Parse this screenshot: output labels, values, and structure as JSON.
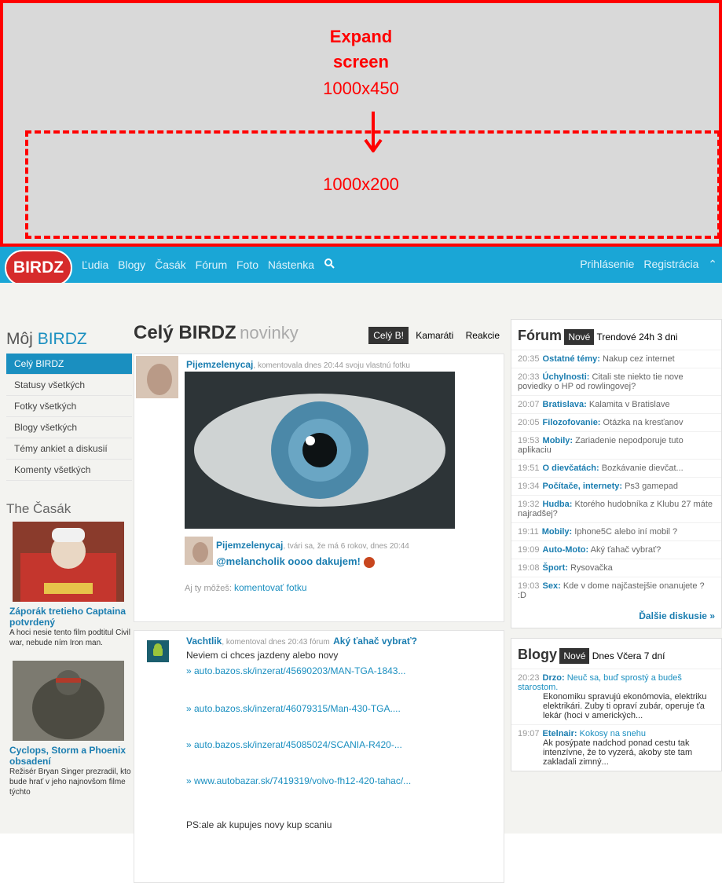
{
  "banner": {
    "title_line1": "Expand",
    "title_line2": "screen",
    "size_expanded": "1000x450",
    "size_collapsed": "1000x200"
  },
  "nav": {
    "logo": "BIRDZ",
    "links": [
      "Ľudia",
      "Blogy",
      "Časák",
      "Fórum",
      "Foto",
      "Nástenka"
    ],
    "login": "Prihlásenie",
    "register": "Registrácia"
  },
  "sidebar": {
    "title_prefix": "Môj",
    "title_brand": "BIRDZ",
    "items": [
      "Celý BIRDZ",
      "Statusy všetkých",
      "Fotky všetkých",
      "Blogy všetkých",
      "Témy ankiet a diskusií",
      "Komenty všetkých"
    ]
  },
  "casak": {
    "title": "The Časák",
    "articles": [
      {
        "headline": "Záporák tretieho Captaina potvrdený",
        "text": "A hoci nesie tento film podtitul Civil war, nebude ním Iron man."
      },
      {
        "headline": "Cyclops, Storm a Phoenix obsadení",
        "text": "Režisér Bryan Singer prezradil, kto bude hrať v jeho najnovšom filme týchto"
      }
    ]
  },
  "feed": {
    "title": "Celý BIRDZ",
    "subtitle": "novinky",
    "tabs": [
      "Celý B!",
      "Kamaráti",
      "Reakcie"
    ],
    "post1": {
      "author": "Pijemzelenycaj",
      "meta": ", komentovala dnes 20:44 svoju vlastnú fotku",
      "reply_author": "Pijemzelenycaj",
      "reply_meta": ", tvári sa, že má 6 rokov, dnes 20:44",
      "reply_text": "@melancholik oooo dakujem!",
      "cta_prefix": "Aj ty môžeš:",
      "cta": "komentovať fotku"
    },
    "post2": {
      "author": "Vachtlik",
      "meta": ", komentoval dnes 20:43 fórum",
      "topic": "Aký ťahač vybrať?",
      "line1": "Neviem ci chces jazdeny alebo novy",
      "links": [
        "» auto.bazos.sk/inzerat/45690203/MAN-TGA-1843...",
        "» auto.bazos.sk/inzerat/46079315/Man-430-TGA....",
        "» auto.bazos.sk/inzerat/45085024/SCANIA-R420-...",
        "» www.autobazar.sk/7419319/volvo-fh12-420-tahac/..."
      ],
      "footer": "PS:ale ak kupujes novy kup scaniu"
    }
  },
  "forum": {
    "title": "Fórum",
    "tabs": [
      "Nové",
      "Trendové",
      "24h",
      "3 dni"
    ],
    "items": [
      {
        "time": "20:35",
        "cat": "Ostatné témy:",
        "text": "Nakup cez internet"
      },
      {
        "time": "20:33",
        "cat": "Úchylnosti:",
        "text": "Citali ste niekto tie nove poviedky o HP od rowlingovej?"
      },
      {
        "time": "20:07",
        "cat": "Bratislava:",
        "text": "Kalamita v Bratislave"
      },
      {
        "time": "20:05",
        "cat": "Filozofovanie:",
        "text": "Otázka na kresťanov"
      },
      {
        "time": "19:53",
        "cat": "Mobily:",
        "text": "Zariadenie nepodporuje tuto aplikaciu"
      },
      {
        "time": "19:51",
        "cat": "O dievčatách:",
        "text": "Bozkávanie dievčat..."
      },
      {
        "time": "19:34",
        "cat": "Počítače, internety:",
        "text": "Ps3 gamepad"
      },
      {
        "time": "19:32",
        "cat": "Hudba:",
        "text": "Ktorého hudobníka z Klubu 27 máte najradšej?"
      },
      {
        "time": "19:11",
        "cat": "Mobily:",
        "text": "Iphone5C alebo iní mobil ?"
      },
      {
        "time": "19:09",
        "cat": "Auto-Moto:",
        "text": "Aký ťahač vybrať?"
      },
      {
        "time": "19:08",
        "cat": "Šport:",
        "text": "Rysovačka"
      },
      {
        "time": "19:03",
        "cat": "Sex:",
        "text": "Kde v dome najčastejšie onanujete ? :D"
      }
    ],
    "more": "Ďalšie diskusie »"
  },
  "blogy": {
    "title": "Blogy",
    "tabs": [
      "Nové",
      "Dnes",
      "Včera",
      "7 dní"
    ],
    "items": [
      {
        "time": "20:23",
        "author": "Drzo:",
        "title": "Neuč sa, buď sprostý a budeš starostom.",
        "excerpt": "Ekonomiku spravujú ekonómovia, elektriku elektrikári. Zuby ti opraví zubár, operuje ťa lekár (hoci v amerických..."
      },
      {
        "time": "19:07",
        "author": "Etelnair:",
        "title": "Kokosy na snehu",
        "excerpt": "Ak posýpate nadchod ponad cestu tak intenzívne, že to vyzerá, akoby ste tam zakladali zimný..."
      }
    ]
  },
  "colors": {
    "accent": "#1aa6d6",
    "brand_red": "#d62b2b",
    "link": "#1a7db0"
  }
}
